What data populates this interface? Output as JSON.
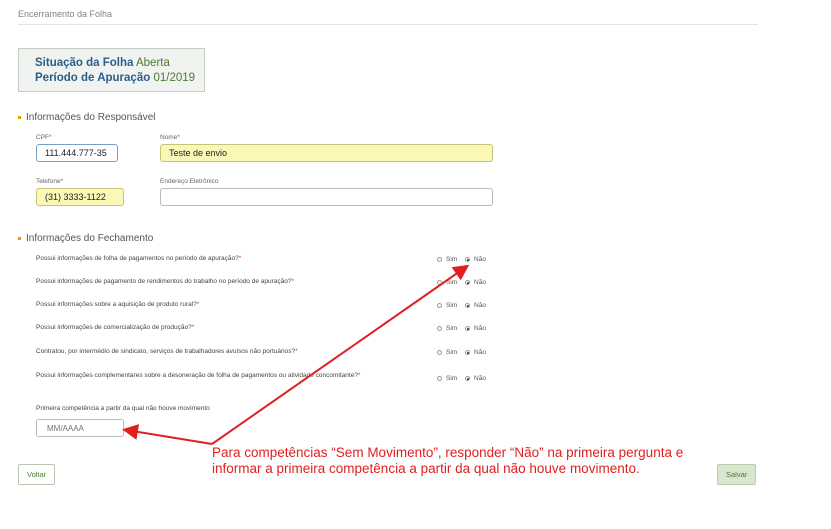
{
  "page": {
    "title": "Encerramento da Folha"
  },
  "status": {
    "situacao_label": "Situação da Folha",
    "situacao_value": "Aberta",
    "periodo_label": "Período de Apuração",
    "periodo_value": "01/2019"
  },
  "responsavel": {
    "section_title": "Informações do Responsável",
    "cpf": {
      "label": "CPF",
      "value": "111.444.777-35",
      "required": "*"
    },
    "nome": {
      "label": "Nome",
      "value": "Teste de envio",
      "required": "*"
    },
    "telefone": {
      "label": "Telefone",
      "value": "(31) 3333-1122",
      "required": "*"
    },
    "email": {
      "label": "Endereço Eletrônico",
      "value": ""
    }
  },
  "fechamento": {
    "section_title": "Informações do Fechamento",
    "yes_label": "Sim",
    "no_label": "Não",
    "questions": [
      {
        "text": "Possui informações de folha de pagamentos no período de apuração?",
        "required": "*",
        "answer": "no"
      },
      {
        "text": "Possui informações de pagamento de rendimentos do trabalho no período de apuração?",
        "required": "*",
        "answer": "no"
      },
      {
        "text": "Possui informações sobre a aquisição de produto rural?",
        "required": "*",
        "answer": "no"
      },
      {
        "text": "Possui informações de comercialização de produção?",
        "required": "*",
        "answer": "no"
      },
      {
        "text": "Contratou, por intermédio de sindicato, serviços de trabalhadores avulsos não portuários?",
        "required": "*",
        "answer": "no"
      },
      {
        "text": "Possui informações complementares sobre a desoneração de folha de pagamentos ou atividade concomitante?",
        "required": "*",
        "answer": "no"
      }
    ],
    "competencia_label": "Primeira competência a partir da qual não houve movimento",
    "competencia_placeholder": "MM/AAAA"
  },
  "buttons": {
    "back": "Voltar",
    "save": "Salvar"
  },
  "annotation": {
    "text": "Para competências “Sem Movimento”, responder “Não” na primeira pergunta e informar a primeira competência a partir da qual não houve movimento.",
    "color": "#e02020"
  },
  "colors": {
    "accent": "#4b7a2f",
    "label_blue": "#2a5e8a",
    "bullet": "#e8a000"
  }
}
